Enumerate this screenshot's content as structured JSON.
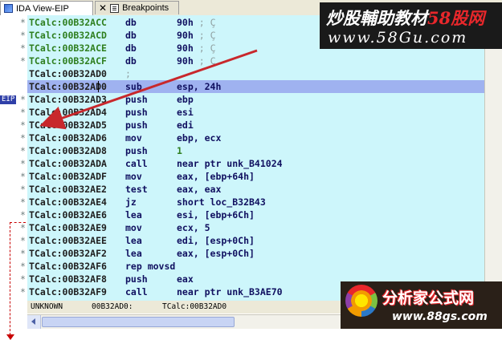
{
  "tabs": [
    {
      "label": "IDA View-EIP",
      "icon": "ida-view-icon",
      "active": true
    },
    {
      "label": "Breakpoints",
      "icon": "breakpoints-list-icon",
      "active": false
    }
  ],
  "eip_label": "EIP",
  "disasm": [
    {
      "addr": "TCalc:00B32ACC",
      "mn": "db",
      "op": "90h",
      "cmt": "; Ç",
      "bullet": "*",
      "style": "data"
    },
    {
      "addr": "TCalc:00B32ACD",
      "mn": "db",
      "op": "90h",
      "cmt": "; Ç",
      "bullet": "*",
      "style": "data"
    },
    {
      "addr": "TCalc:00B32ACE",
      "mn": "db",
      "op": "90h",
      "cmt": "; Ç",
      "bullet": "*",
      "style": "data"
    },
    {
      "addr": "TCalc:00B32ACF",
      "mn": "db",
      "op": "90h",
      "cmt": "; Ç",
      "bullet": "*",
      "style": "data"
    },
    {
      "addr": "TCalc:00B32AD0",
      "mn": "",
      "op": "",
      "cmt": ";",
      "bullet": "",
      "style": "code"
    },
    {
      "addr": "TCalc:00B32AD0",
      "mn": "sub",
      "op": "esp, 24h",
      "cmt": "",
      "bullet": "",
      "style": "code",
      "current": true
    },
    {
      "addr": "TCalc:00B32AD3",
      "mn": "push",
      "op": "ebp",
      "cmt": "",
      "bullet": "*",
      "style": "code"
    },
    {
      "addr": "TCalc:00B32AD4",
      "mn": "push",
      "op": "esi",
      "cmt": "",
      "bullet": "*",
      "style": "code"
    },
    {
      "addr": "TCalc:00B32AD5",
      "mn": "push",
      "op": "edi",
      "cmt": "",
      "bullet": "*",
      "style": "code"
    },
    {
      "addr": "TCalc:00B32AD6",
      "mn": "mov",
      "op": "ebp, ecx",
      "cmt": "",
      "bullet": "*",
      "style": "code"
    },
    {
      "addr": "TCalc:00B32AD8",
      "mn": "push",
      "op": "1",
      "cmt": "",
      "bullet": "*",
      "style": "code",
      "op_green": true
    },
    {
      "addr": "TCalc:00B32ADA",
      "mn": "call",
      "op": "near ptr unk_B41024",
      "cmt": "",
      "bullet": "*",
      "style": "code"
    },
    {
      "addr": "TCalc:00B32ADF",
      "mn": "mov",
      "op": "eax, [ebp+64h]",
      "cmt": "",
      "bullet": "*",
      "style": "code"
    },
    {
      "addr": "TCalc:00B32AE2",
      "mn": "test",
      "op": "eax, eax",
      "cmt": "",
      "bullet": "*",
      "style": "code"
    },
    {
      "addr": "TCalc:00B32AE4",
      "mn": "jz",
      "op": "short loc_B32B43",
      "cmt": "",
      "bullet": "*",
      "style": "code"
    },
    {
      "addr": "TCalc:00B32AE6",
      "mn": "lea",
      "op": "esi, [ebp+6Ch]",
      "cmt": "",
      "bullet": "*",
      "style": "code"
    },
    {
      "addr": "TCalc:00B32AE9",
      "mn": "mov",
      "op": "ecx, 5",
      "cmt": "",
      "bullet": "*",
      "style": "code"
    },
    {
      "addr": "TCalc:00B32AEE",
      "mn": "lea",
      "op": "edi, [esp+0Ch]",
      "cmt": "",
      "bullet": "*",
      "style": "code"
    },
    {
      "addr": "TCalc:00B32AF2",
      "mn": "lea",
      "op": "eax, [esp+0Ch]",
      "cmt": "",
      "bullet": "*",
      "style": "code"
    },
    {
      "addr": "TCalc:00B32AF6",
      "mn": "rep movsd",
      "op": "",
      "cmt": "",
      "bullet": "*",
      "style": "code"
    },
    {
      "addr": "TCalc:00B32AF8",
      "mn": "push",
      "op": "eax",
      "cmt": "",
      "bullet": "*",
      "style": "code"
    },
    {
      "addr": "TCalc:00B32AF9",
      "mn": "call",
      "op": "near ptr unk_B3AE70",
      "cmt": "",
      "bullet": "*",
      "style": "code"
    }
  ],
  "status": {
    "mode": "UNKNOWN",
    "offset": "00B32AD0:",
    "location": "TCalc:00B32AD0"
  },
  "watermark_top": {
    "line1_cn": "炒股輔助教材",
    "line1_red": "58股网",
    "line2": "www.58Gu.com"
  },
  "watermark_bottom": {
    "title": "分析家公式网",
    "url": "www.88gs.com"
  },
  "colors": {
    "code_bg": "#cdf6fb",
    "current_line": "#9fb2f0",
    "eip_badge": "#2f3fa8",
    "annotation_arrow": "#c8282c"
  }
}
